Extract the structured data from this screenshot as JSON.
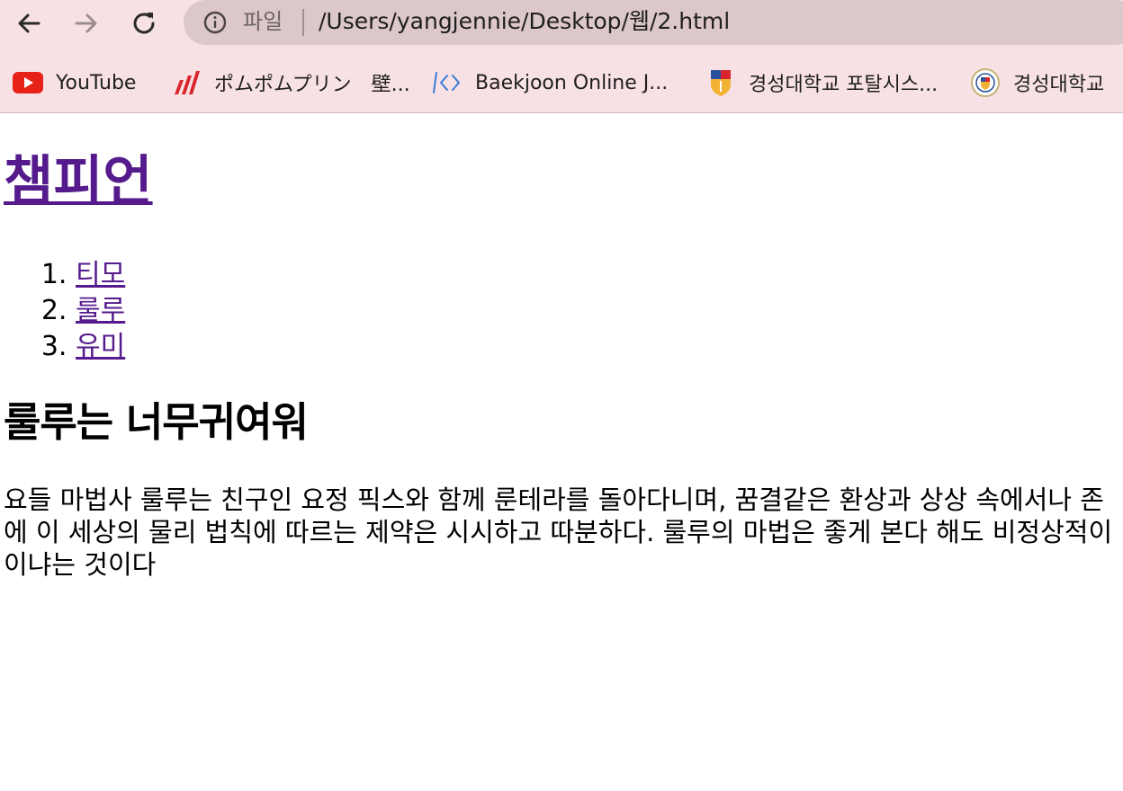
{
  "browser": {
    "omnibox": {
      "scheme_label": "파일",
      "url": "/Users/yangjennie/Desktop/웹/2.html"
    },
    "bookmarks": [
      {
        "label": "YouTube",
        "icon": "youtube-icon"
      },
      {
        "label": "ポムポムプリン　壁...",
        "icon": "bookmark-favicon-icon"
      },
      {
        "label": "Baekjoon Online J...",
        "icon": "code-icon"
      },
      {
        "label": "경성대학교 포탈시스...",
        "icon": "shield-logo-icon"
      },
      {
        "label": "경성대학교",
        "icon": "university-seal-icon"
      }
    ]
  },
  "page": {
    "title": "챔피언",
    "champions": [
      "티모",
      "룰루",
      "유미"
    ],
    "heading": "룰루는 너무귀여워",
    "description_lines": [
      "요들 마법사 룰루는 친구인 요정 픽스와 함께 룬테라를 돌아다니며, 꿈결같은 환상과 상상 속에서나 존",
      "에 이 세상의 물리 법칙에 따르는 제약은 시시하고 따분하다. 룰루의 마법은 좋게 본다 해도 비정상적이",
      "이냐는 것이다"
    ]
  },
  "colors": {
    "chrome_background": "#f8e1e4",
    "omnibox_background": "#dcc7ca",
    "visited_link": "#551a8b"
  }
}
